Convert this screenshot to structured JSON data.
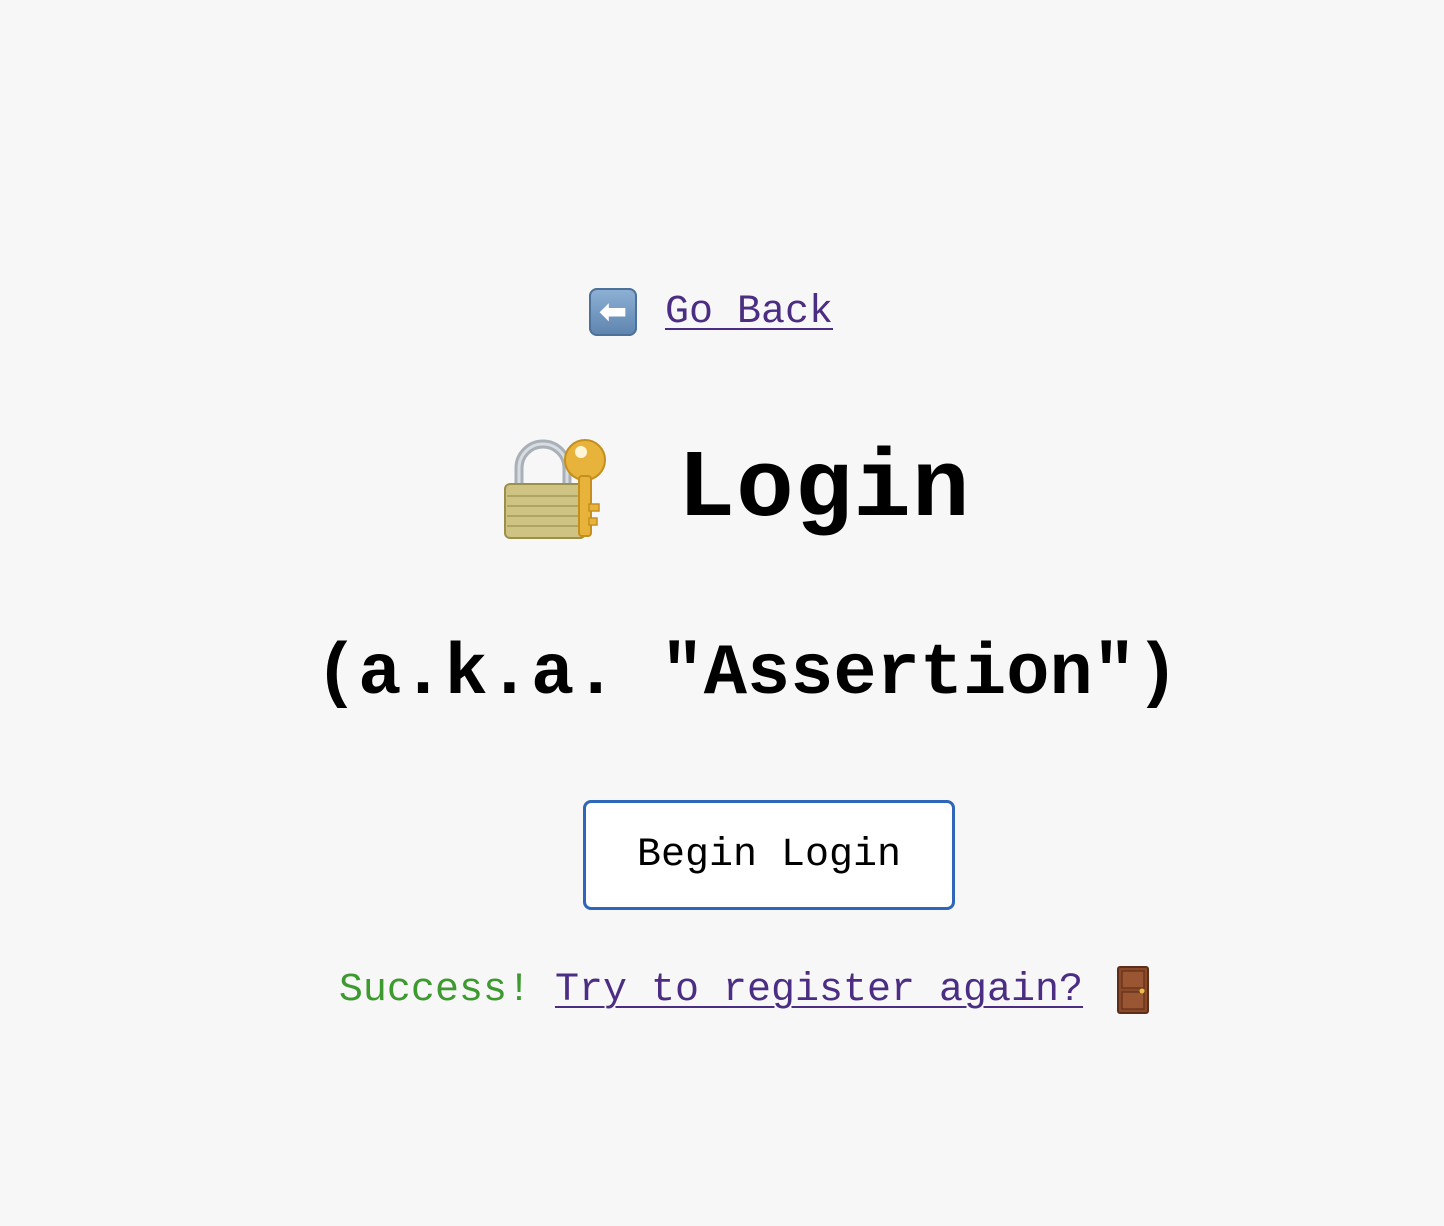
{
  "nav": {
    "back_label": "Go Back"
  },
  "header": {
    "title": "Login",
    "subtitle": "(a.k.a. \"Assertion\")"
  },
  "actions": {
    "begin_label": "Begin Login"
  },
  "status": {
    "success_text": "Success! ",
    "register_link": "Try to register again?"
  },
  "icons": {
    "back": "back-arrow-icon",
    "title": "locked-with-key-icon",
    "status": "door-icon"
  },
  "colors": {
    "background": "#f7f7f7",
    "link": "#4b2e83",
    "success": "#3c9a2e",
    "button_border": "#2f66b9"
  }
}
